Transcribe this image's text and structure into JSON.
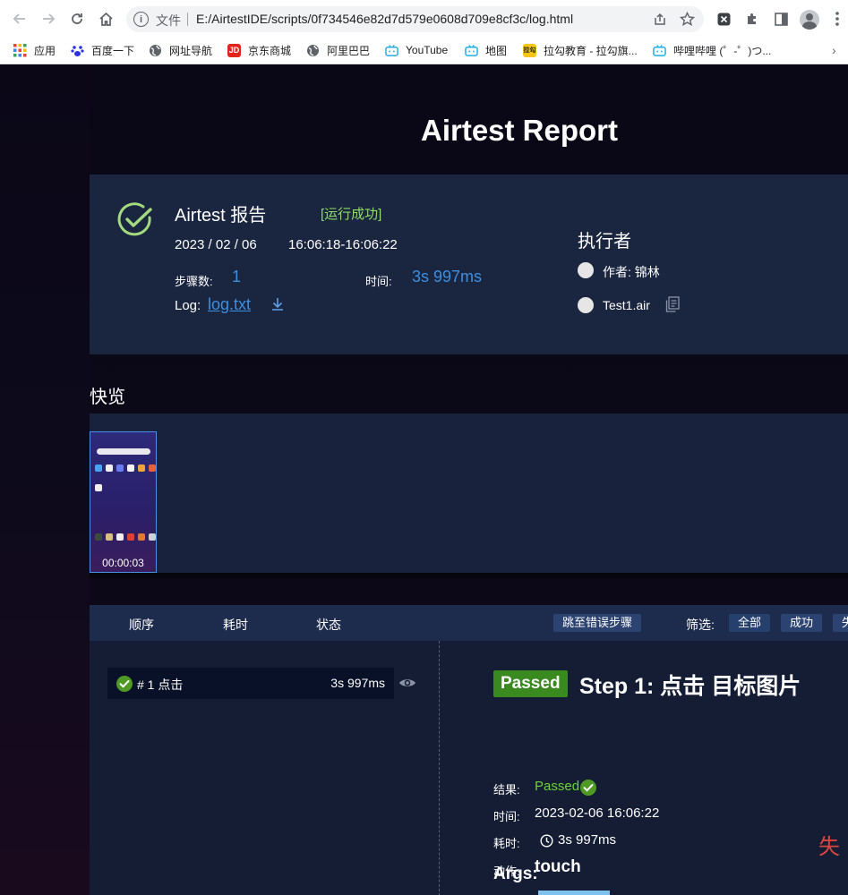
{
  "browser": {
    "omnibox": {
      "label": "文件",
      "url": "E:/AirtestIDE/scripts/0f734546e82d7d579e0608d709e8cf3c/log.html"
    },
    "bookmarks": [
      {
        "label": "应用",
        "icon": "apps-grid-icon",
        "color": "#e0473a"
      },
      {
        "label": "百度一下",
        "icon": "baidu-paw-icon",
        "color": "#2932e1"
      },
      {
        "label": "网址导航",
        "icon": "globe-icon",
        "color": "#5f6368"
      },
      {
        "label": "京东商城",
        "icon": "jd-logo-icon",
        "color": "#e1251b"
      },
      {
        "label": "阿里巴巴",
        "icon": "globe-icon",
        "color": "#5f6368"
      },
      {
        "label": "YouTube",
        "icon": "bilibili-tv-icon",
        "color": "#23ade5"
      },
      {
        "label": "地图",
        "icon": "bilibili-tv-icon",
        "color": "#23ade5"
      },
      {
        "label": "拉勾教育 - 拉勾旗...",
        "icon": "lagou-logo-icon",
        "color": "#f5c518"
      },
      {
        "label": "哔哩哔哩 (゜-゜)つ...",
        "icon": "bilibili-tv-icon",
        "color": "#23ade5"
      }
    ]
  },
  "report": {
    "title": "Airtest Report",
    "summary": {
      "name": "Airtest 报告",
      "status": "[运行成功]",
      "date": "2023 / 02 / 06",
      "time_range": "16:06:18-16:06:22",
      "steps_label": "步骤数:",
      "steps_value": "1",
      "duration_label": "时间:",
      "duration_value": "3s 997ms",
      "log_label": "Log:",
      "log_link": "log.txt",
      "executor_title": "执行者",
      "author": "作者: 锦林",
      "script": "Test1.air"
    },
    "overview": {
      "title": "快览",
      "thumb_time": "00:00:03"
    },
    "steps_header": {
      "order": "顺序",
      "duration": "耗时",
      "status": "状态",
      "jump_error": "跳至错误步骤",
      "filter_label": "筛选:",
      "filter_all": "全部",
      "filter_success": "成功",
      "filter_fail_partial": "失"
    },
    "steps": [
      {
        "name": "# 1 点击",
        "duration": "3s 997ms"
      }
    ],
    "detail": {
      "badge": "Passed",
      "title": "Step 1: 点击 目标图片",
      "result_label": "结果:",
      "result_value": "Passed",
      "time_label": "时间:",
      "time_value": "2023-02-06 16:06:22",
      "cost_label": "耗时:",
      "cost_value": "3s 997ms",
      "action_label": "动作:",
      "action_value": "touch",
      "args_title": "Args:",
      "side_char": "失"
    }
  },
  "colors": {
    "accent_blue": "#3d8fe0",
    "success_green": "#6ed13d",
    "panel": "#1a2540"
  }
}
